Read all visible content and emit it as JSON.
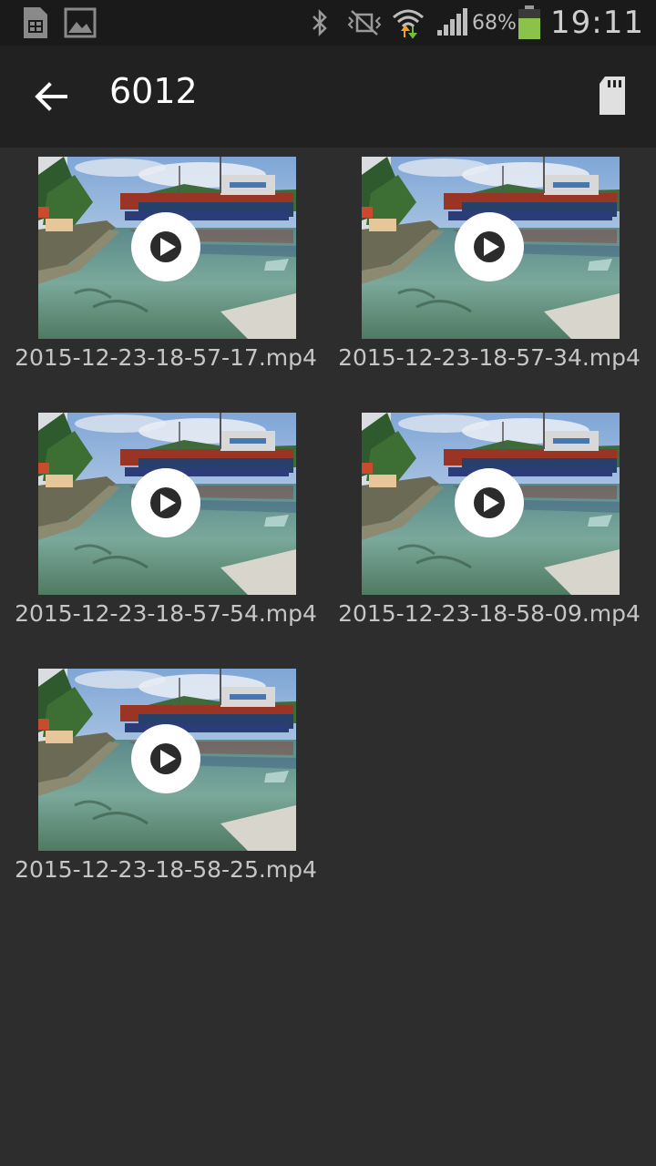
{
  "status_bar": {
    "battery_percent": "68%",
    "time": "19:11",
    "icons": [
      "sim-card-icon",
      "image-notification-icon",
      "bluetooth-icon",
      "vibrate-mute-icon",
      "wifi-icon",
      "signal-icon",
      "battery-icon"
    ],
    "battery_color": "#8bc34a"
  },
  "app_bar": {
    "title": "6012",
    "back_icon": "arrow-left-icon",
    "storage_icon": "sd-card-icon"
  },
  "files": [
    {
      "name": "2015-12-23-18-57-17.mp4"
    },
    {
      "name": "2015-12-23-18-57-34.mp4"
    },
    {
      "name": "2015-12-23-18-57-54.mp4"
    },
    {
      "name": "2015-12-23-18-58-09.mp4"
    },
    {
      "name": "2015-12-23-18-58-25.mp4"
    }
  ]
}
